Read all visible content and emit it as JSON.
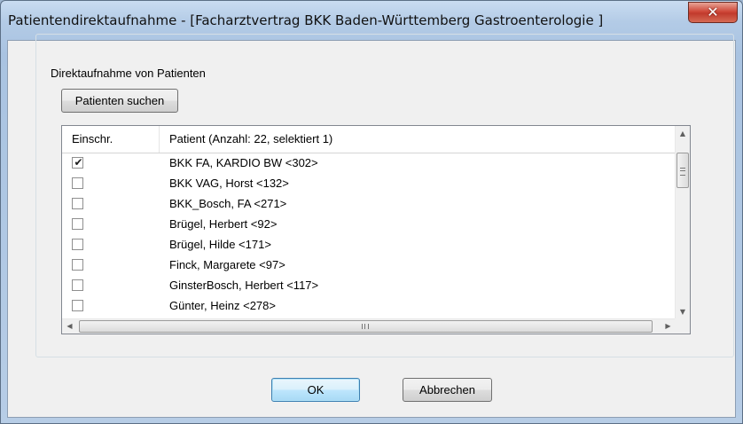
{
  "window": {
    "title": "Patientendirektaufnahme - [Facharztvertrag BKK Baden-Württemberg Gastroenterologie ]",
    "close_icon": "close-icon"
  },
  "group": {
    "label": "Direktaufnahme von Patienten"
  },
  "buttons": {
    "search": "Patienten suchen",
    "ok": "OK",
    "cancel": "Abbrechen"
  },
  "list": {
    "columns": [
      "Einschr.",
      "Patient (Anzahl: 22, selektiert 1)"
    ],
    "rows": [
      {
        "checked": true,
        "check_mark": "✔",
        "name": "BKK FA,  KARDIO BW <302>"
      },
      {
        "checked": false,
        "check_mark": "",
        "name": "BKK VAG,  Horst <132>"
      },
      {
        "checked": false,
        "check_mark": "",
        "name": "BKK_Bosch,  FA <271>"
      },
      {
        "checked": false,
        "check_mark": "",
        "name": "Brügel,  Herbert <92>"
      },
      {
        "checked": false,
        "check_mark": "",
        "name": "Brügel,  Hilde <171>"
      },
      {
        "checked": false,
        "check_mark": "",
        "name": "Finck,  Margarete <97>"
      },
      {
        "checked": false,
        "check_mark": "",
        "name": "GinsterBosch,  Herbert <117>"
      },
      {
        "checked": false,
        "check_mark": "",
        "name": "Günter,  Heinz <278>"
      }
    ]
  },
  "scrollbar_glyphs": {
    "up": "▲",
    "down": "▼",
    "left": "◀",
    "right": "▶"
  },
  "colors": {
    "close_button": "#c13a2d",
    "titlebar": "#b3cbe6",
    "default_button_border": "#3c7fb1"
  }
}
